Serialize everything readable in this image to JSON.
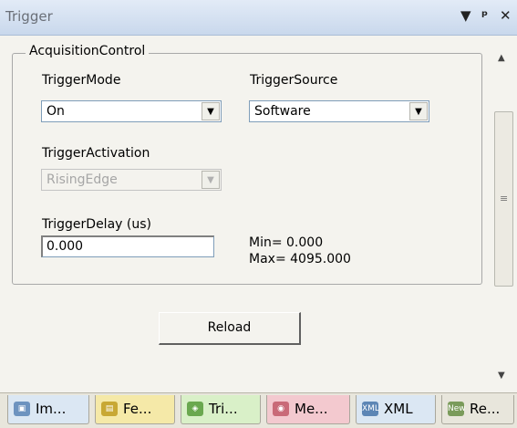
{
  "window": {
    "title": "Trigger",
    "controls": [
      "▼",
      "ᵖ",
      "✕"
    ]
  },
  "group": {
    "legend": "AcquisitionControl",
    "trigger_mode": {
      "label": "TriggerMode",
      "value": "On"
    },
    "trigger_source": {
      "label": "TriggerSource",
      "value": "Software"
    },
    "trigger_activation": {
      "label": "TriggerActivation",
      "value": "RisingEdge"
    },
    "trigger_delay": {
      "label": "TriggerDelay (us)",
      "value": "0.000"
    },
    "range": {
      "min": "Min= 0.000",
      "max": "Max= 4095.000"
    }
  },
  "reload_label": "Reload",
  "scrollbar": {
    "up": "▲",
    "down": "▼",
    "grip": "≡"
  },
  "tabs": [
    {
      "label": "Im...",
      "icon": "image-icon",
      "color": "#dbe7f3"
    },
    {
      "label": "Fe...",
      "icon": "feature-icon",
      "color": "#f5e9a8"
    },
    {
      "label": "Tri...",
      "icon": "trigger-icon",
      "color": "#d9f0c8"
    },
    {
      "label": "Me...",
      "icon": "memory-icon",
      "color": "#f3c9cf"
    },
    {
      "label": "XML",
      "icon": "xml-icon",
      "color": "#dbe7f3"
    },
    {
      "label": "Re...",
      "icon": "register-icon",
      "color": "#e8e6dc"
    }
  ],
  "icons": {
    "image-icon": "▣",
    "feature-icon": "▤",
    "trigger-icon": "◈",
    "memory-icon": "◉",
    "xml-icon": "XML",
    "register-icon": "New"
  }
}
